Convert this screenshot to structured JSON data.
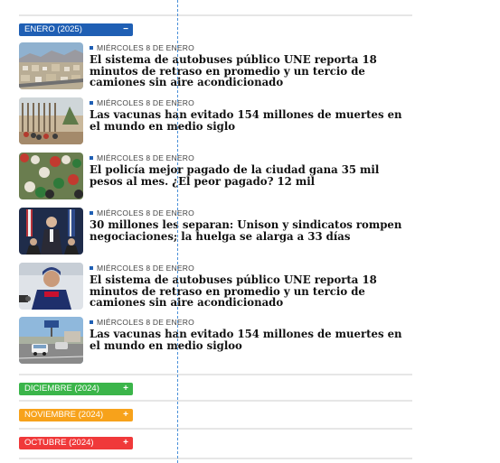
{
  "sections": {
    "enero": {
      "label": "ENERO (2025)",
      "toggle": "−",
      "color": "#1f5fb4"
    },
    "diciembre": {
      "label": "DICIEMBRE (2024)",
      "toggle": "+",
      "color": "#3bb54a"
    },
    "noviembre": {
      "label": "NOVIEMBRE (2024)",
      "toggle": "+",
      "color": "#f7a21b"
    },
    "octubre": {
      "label": "OCTUBRE (2024)",
      "toggle": "+",
      "color": "#f0393a"
    }
  },
  "articles": [
    {
      "date": "MIÉRCOLES 8 DE ENERO",
      "title": "El sistema de autobuses público UNE reporta 18 minutos de retraso en promedio y un tercio de camiones sin aire acondicionado",
      "image": "city-aerial"
    },
    {
      "date": "MIÉRCOLES 8 DE ENERO",
      "title": "Las vacunas han evitado 154 millones de muertes en el mundo en medio siglo",
      "image": "border-wall-crowd"
    },
    {
      "date": "MIÉRCOLES 8 DE ENERO",
      "title": "El policía mejor pagado de la ciudad gana 35 mil pesos al mes. ¿El peor pagado? 12 mil",
      "image": "stadium-crowd"
    },
    {
      "date": "MIÉRCOLES 8 DE ENERO",
      "title": "30 millones les separan: Unison y sindicatos rompen negociaciones; la huelga se alarga a 33 días",
      "image": "press-conference-flags"
    },
    {
      "date": "MIÉRCOLES 8 DE ENERO",
      "title": "El sistema de autobuses público UNE reporta 18 minutos de retraso en promedio y un tercio de camiones sin aire acondicionado",
      "image": "racing-driver-portrait"
    },
    {
      "date": "MIÉRCOLES 8 DE ENERO",
      "title": "Las vacunas han evitado 154 millones de muertes en el mundo en medio sigloo",
      "image": "street-traffic"
    }
  ]
}
